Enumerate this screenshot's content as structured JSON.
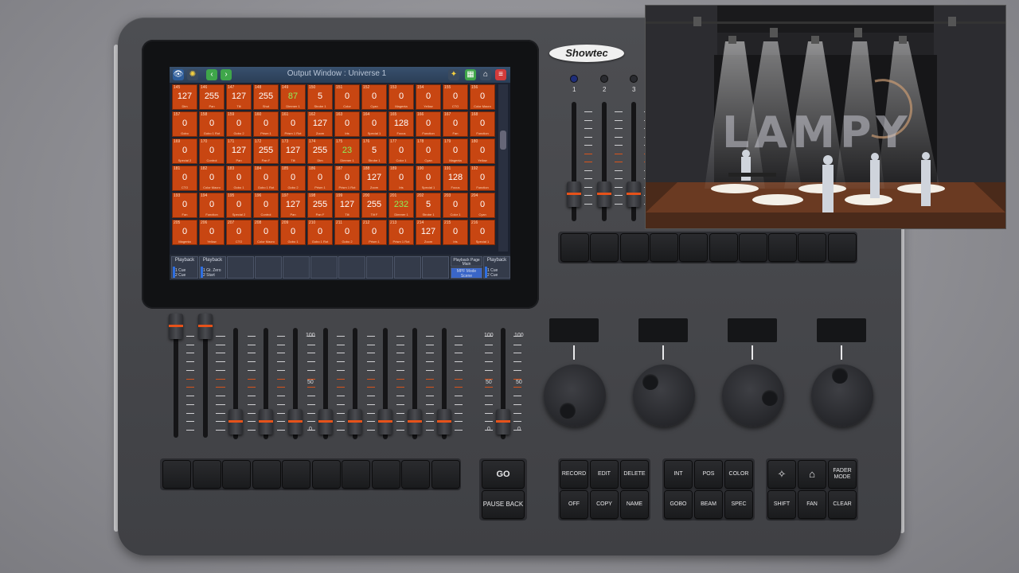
{
  "screen": {
    "window_title": "Output Window : Universe 1",
    "rows": [
      {
        "cells": [
          [
            "145",
            "127",
            "Dim"
          ],
          [
            "146",
            "255",
            "Pan"
          ],
          [
            "147",
            "127",
            "Tilt"
          ],
          [
            "148",
            "255",
            "Shut"
          ],
          [
            "149",
            "87",
            "Dimmer 1"
          ],
          [
            "150",
            "5",
            "Strobe 1"
          ],
          [
            "151",
            "0",
            "Color"
          ],
          [
            "152",
            "0",
            "Cyan"
          ],
          [
            "153",
            "0",
            "Magenta"
          ],
          [
            "154",
            "0",
            "Yellow"
          ],
          [
            "155",
            "0",
            "CTO"
          ],
          [
            "156",
            "0",
            "Color Macro"
          ]
        ],
        "hi": [
          4
        ]
      },
      {
        "cells": [
          [
            "157",
            "0",
            "Gobo"
          ],
          [
            "158",
            "0",
            "Gobo 1 Rot"
          ],
          [
            "159",
            "0",
            "Gobo 2"
          ],
          [
            "160",
            "0",
            "Prism 1"
          ],
          [
            "161",
            "0",
            "Prism 1 Rot"
          ],
          [
            "162",
            "127",
            "Zoom"
          ],
          [
            "163",
            "0",
            "Iris"
          ],
          [
            "164",
            "0",
            "Special 1"
          ],
          [
            "165",
            "128",
            "Focus"
          ],
          [
            "166",
            "0",
            "Function"
          ],
          [
            "167",
            "0",
            "Fan"
          ],
          [
            "168",
            "0",
            "Function"
          ]
        ],
        "hi": []
      },
      {
        "cells": [
          [
            "169",
            "0",
            "Special 2"
          ],
          [
            "170",
            "0",
            "Control"
          ],
          [
            "171",
            "127",
            "Pan"
          ],
          [
            "172",
            "255",
            "Pan F"
          ],
          [
            "173",
            "127",
            "Tilt"
          ],
          [
            "174",
            "255",
            "Dim"
          ],
          [
            "175",
            "23",
            "Dimmer 1"
          ],
          [
            "176",
            "5",
            "Strobe 1"
          ],
          [
            "177",
            "0",
            "Color 1"
          ],
          [
            "178",
            "0",
            "Cyan"
          ],
          [
            "179",
            "0",
            "Magenta"
          ],
          [
            "180",
            "0",
            "Yellow"
          ]
        ],
        "hi": [
          6
        ]
      },
      {
        "cells": [
          [
            "181",
            "0",
            "CTO"
          ],
          [
            "182",
            "0",
            "Color Macro"
          ],
          [
            "183",
            "0",
            "Gobo 1"
          ],
          [
            "184",
            "0",
            "Gobo 1 Rot"
          ],
          [
            "185",
            "0",
            "Gobo 2"
          ],
          [
            "186",
            "0",
            "Prism 1"
          ],
          [
            "187",
            "0",
            "Prism 1 Rot"
          ],
          [
            "188",
            "127",
            "Zoom"
          ],
          [
            "189",
            "0",
            "Iris"
          ],
          [
            "190",
            "0",
            "Special 1"
          ],
          [
            "191",
            "128",
            "Focus"
          ],
          [
            "192",
            "0",
            "Function"
          ]
        ],
        "hi": []
      },
      {
        "cells": [
          [
            "193",
            "0",
            "Fan"
          ],
          [
            "194",
            "0",
            "Function"
          ],
          [
            "195",
            "0",
            "Special 2"
          ],
          [
            "196",
            "0",
            "Control"
          ],
          [
            "197",
            "127",
            "Pan"
          ],
          [
            "198",
            "255",
            "Pan F"
          ],
          [
            "199",
            "127",
            "Tilt"
          ],
          [
            "200",
            "255",
            "Tilt F"
          ],
          [
            "201",
            "232",
            "Dimmer 1"
          ],
          [
            "202",
            "5",
            "Strobe 1"
          ],
          [
            "203",
            "0",
            "Color 1"
          ],
          [
            "204",
            "0",
            "Cyan"
          ]
        ],
        "hi": [
          8
        ]
      },
      {
        "cells": [
          [
            "205",
            "0",
            "Magenta"
          ],
          [
            "206",
            "0",
            "Yellow"
          ],
          [
            "207",
            "0",
            "CTO"
          ],
          [
            "208",
            "0",
            "Color Macro"
          ],
          [
            "209",
            "0",
            "Gobo 1"
          ],
          [
            "210",
            "0",
            "Gobo 1 Rot"
          ],
          [
            "211",
            "0",
            "Gobo 2"
          ],
          [
            "212",
            "0",
            "Prism 1"
          ],
          [
            "213",
            "0",
            "Prism 1 Rot"
          ],
          [
            "214",
            "127",
            "Zoom"
          ],
          [
            "215",
            "0",
            "Iris"
          ],
          [
            "216",
            "0",
            "Special 1"
          ]
        ],
        "hi": []
      }
    ],
    "playback_left": {
      "title": "Playback",
      "line1": "1 Cue",
      "line2": "2 Cue"
    },
    "playback_left2": {
      "title": "Playback",
      "line1": "1 Gt. Zero",
      "line2": "2 Start"
    },
    "playback_page": {
      "title": "Playback Page",
      "value": "Main"
    },
    "mpf_mode": {
      "title": "MPF Mode",
      "value": "Scene"
    },
    "playback_right": {
      "title": "Playback",
      "line1": "1 Cue",
      "line2": "2 Cue"
    }
  },
  "logo": "Showtec",
  "led_labels": [
    "1",
    "2",
    "3"
  ],
  "fader_scale": {
    "top": "100",
    "mid": "50",
    "bottom": "0"
  },
  "buttons": {
    "go": "GO",
    "pause_back": "PAUSE BACK",
    "record": "RECORD",
    "edit": "EDIT",
    "delete": "DELETE",
    "off": "OFF",
    "copy": "COPY",
    "name": "NAME",
    "int": "INT",
    "pos": "POS",
    "color": "COLOR",
    "gobo": "GOBO",
    "beam": "BEAM",
    "spec": "SPEC",
    "fader_mode": "FADER MODE",
    "shift": "SHIFT",
    "fan": "FAN",
    "clear": "CLEAR"
  },
  "stage_text": "LAMPY",
  "colors": {
    "cell": "#c84612",
    "highlight": "#8cf05a",
    "fader_mark": "#e6521a",
    "select_led": "#2f6fe0"
  }
}
